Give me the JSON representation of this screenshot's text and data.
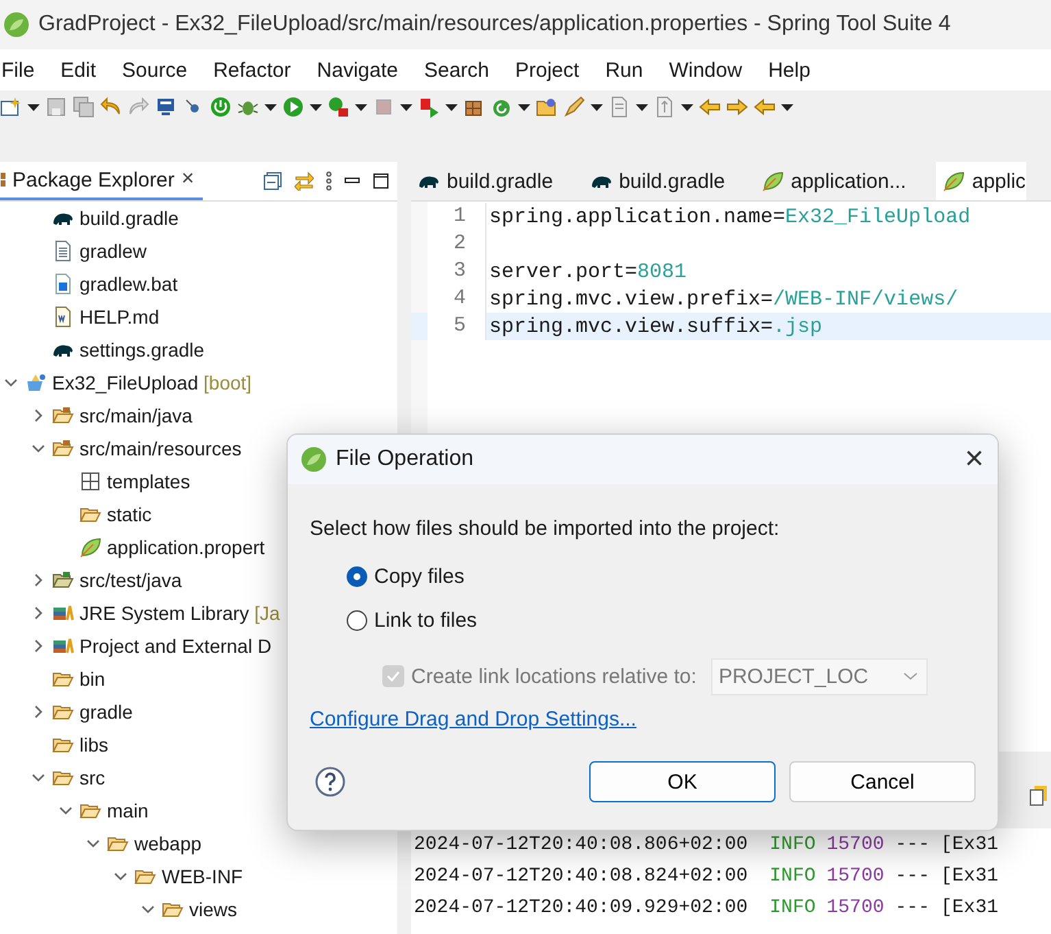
{
  "window": {
    "title": "GradProject - Ex32_FileUpload/src/main/resources/application.properties - Spring Tool Suite 4"
  },
  "menu": [
    "File",
    "Edit",
    "Source",
    "Refactor",
    "Navigate",
    "Search",
    "Project",
    "Run",
    "Window",
    "Help"
  ],
  "package_explorer": {
    "title": "Package Explorer",
    "close": "×",
    "tree": [
      {
        "label": "build.gradle",
        "kind": "gradle"
      },
      {
        "label": "gradlew",
        "kind": "file"
      },
      {
        "label": "gradlew.bat",
        "kind": "bat"
      },
      {
        "label": "HELP.md",
        "kind": "doc"
      },
      {
        "label": "settings.gradle",
        "kind": "gradle"
      },
      {
        "label": "Ex32_FileUpload",
        "decoration": "[boot]",
        "kind": "project",
        "expanded": true,
        "children": [
          {
            "label": "src/main/java",
            "kind": "package",
            "expanded": false
          },
          {
            "label": "src/main/resources",
            "kind": "package",
            "expanded": true,
            "children": [
              {
                "label": "templates",
                "kind": "grid"
              },
              {
                "label": "static",
                "kind": "folder"
              },
              {
                "label": "application.propert",
                "kind": "leaf"
              }
            ]
          },
          {
            "label": "src/test/java",
            "kind": "testpackage",
            "expanded": false
          },
          {
            "label": "JRE System Library",
            "decoration": "[Ja",
            "kind": "library",
            "expanded": false
          },
          {
            "label": "Project and External D",
            "kind": "library",
            "expanded": false
          },
          {
            "label": "bin",
            "kind": "folder"
          },
          {
            "label": "gradle",
            "kind": "folder",
            "expanded": false
          },
          {
            "label": "libs",
            "kind": "folder"
          },
          {
            "label": "src",
            "kind": "folder",
            "expanded": true,
            "children": [
              {
                "label": "main",
                "kind": "folder",
                "expanded": true,
                "children": [
                  {
                    "label": "webapp",
                    "kind": "folder",
                    "expanded": true,
                    "children": [
                      {
                        "label": "WEB-INF",
                        "kind": "folder",
                        "expanded": true,
                        "children": [
                          {
                            "label": "views",
                            "kind": "folder",
                            "expanded": true
                          }
                        ]
                      }
                    ]
                  }
                ]
              }
            ]
          }
        ]
      }
    ]
  },
  "editor": {
    "tabs": [
      {
        "label": "build.gradle",
        "kind": "gradle",
        "selected": false
      },
      {
        "label": "build.gradle",
        "kind": "gradle",
        "selected": false
      },
      {
        "label": "application...",
        "kind": "leaf",
        "selected": false
      },
      {
        "label": "applic",
        "kind": "leaf",
        "selected": true
      }
    ],
    "lines": [
      {
        "number": "1",
        "key": "spring.application.name=",
        "value": "Ex32_FileUpload",
        "current": false
      },
      {
        "number": "2",
        "current": false
      },
      {
        "number": "3",
        "key": "server.port=",
        "value": "8081",
        "current": false
      },
      {
        "number": "4",
        "key": "spring.mvc.view.prefix=",
        "value": "/WEB-INF/views/",
        "current": false
      },
      {
        "number": "5",
        "key": "spring.mvc.view.suffix=",
        "value": ".jsp",
        "current": true
      }
    ]
  },
  "console": {
    "rows": [
      {
        "time": "2024-07-12T20:40:08.806+02:00",
        "level": "INFO",
        "pid": "15700",
        "separator": "---",
        "thread": "[Ex31"
      },
      {
        "time": "2024-07-12T20:40:08.824+02:00",
        "level": "INFO",
        "pid": "15700",
        "separator": "---",
        "thread": "[Ex31"
      },
      {
        "time": "2024-07-12T20:40:09.929+02:00",
        "level": "INFO",
        "pid": "15700",
        "separator": "---",
        "thread": "[Ex31"
      }
    ]
  },
  "dialog": {
    "title": "File Operation",
    "close": "×",
    "prompt": "Select how files should be imported into the project:",
    "options": [
      {
        "label": "Copy files",
        "selected": true
      },
      {
        "label": "Link to files",
        "selected": false
      }
    ],
    "relative": {
      "label": "Create link locations relative to:",
      "checked": true,
      "disabled": true,
      "value": "PROJECT_LOC"
    },
    "link": "Configure Drag and Drop Settings...",
    "buttons": [
      {
        "label": "OK",
        "default": true
      },
      {
        "label": "Cancel",
        "default": false
      }
    ]
  }
}
